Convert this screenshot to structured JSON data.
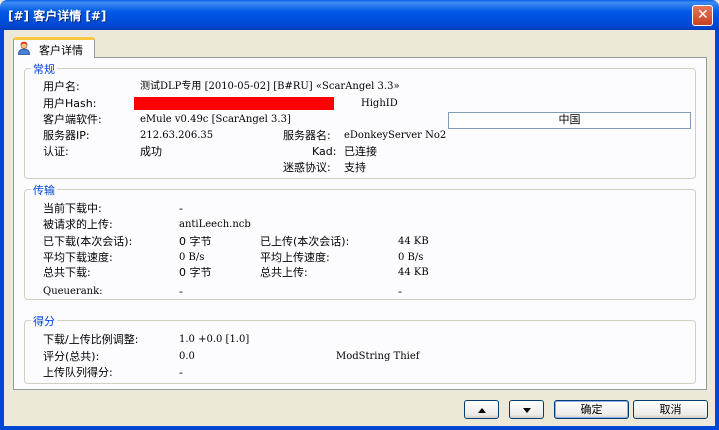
{
  "window": {
    "title": "[#] 客户详情 [#]",
    "close_glyph": "✕"
  },
  "tab": {
    "label": "客户详情",
    "icon": "user-icon"
  },
  "general": {
    "title": "常规",
    "username_label": "用户名:",
    "username_value": "测试DLP专用 [2010-05-02] [B#RU] «ScarAngel 3.3»",
    "userhash_label": "用户Hash:",
    "userhash_redacted_color": "#ff0000",
    "highid": "HighID",
    "client_label": "客户端软件:",
    "client_value": "eMule v0.49c [ScarAngel 3.3]",
    "country": "中国",
    "server_ip_label": "服务器IP:",
    "server_ip_value": "212.63.206.35",
    "server_name_label": "服务器名:",
    "server_name_value": "eDonkeyServer No2",
    "auth_label": "认证:",
    "auth_value": "成功",
    "kad_label": "Kad:",
    "kad_value": "已连接",
    "obfuscation_label": "迷惑协议:",
    "obfuscation_value": "支持"
  },
  "transfer": {
    "title": "传输",
    "current_download_label": "当前下载中:",
    "current_download_value": "-",
    "requested_upload_label": "被请求的上传:",
    "requested_upload_value": "antiLeech.ncb",
    "downloaded_session_label": "已下载(本次会话):",
    "downloaded_session_value": "0 字节",
    "uploaded_session_label": "已上传(本次会话):",
    "uploaded_session_value": "44 KB",
    "avg_down_label": "平均下载速度:",
    "avg_down_value": "0 B/s",
    "avg_up_label": "平均上传速度:",
    "avg_up_value": "0 B/s",
    "total_down_label": "总共下载:",
    "total_down_value": "0 字节",
    "total_up_label": "总共上传:",
    "total_up_value": "44 KB",
    "queuerank_label": "Queuerank:",
    "queuerank_value": "-",
    "queuerank_value2": "-"
  },
  "score": {
    "title": "得分",
    "ratio_label": "下载/上传比例调整:",
    "ratio_value": "1.0 +0.0 [1.0]",
    "rating_label": "评分(总共):",
    "rating_value": "0.0",
    "modstring": "ModString Thief",
    "queue_score_label": "上传队列得分:",
    "queue_score_value": "-"
  },
  "buttons": {
    "ok": "确定",
    "cancel": "取消"
  }
}
